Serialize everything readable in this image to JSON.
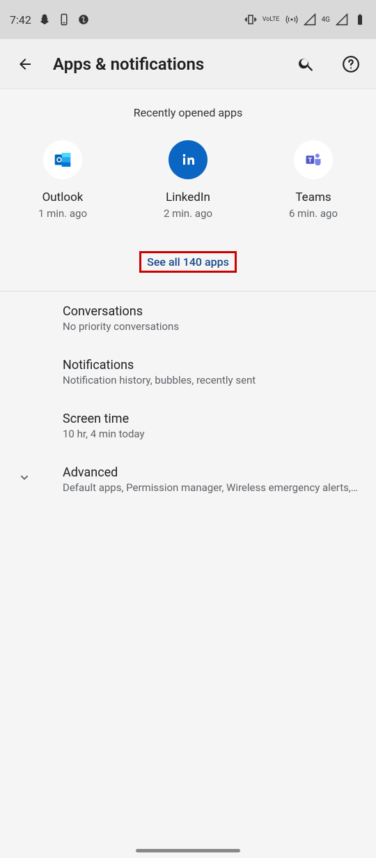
{
  "status": {
    "time": "7:42",
    "volte": "VoLTE",
    "network": "4G"
  },
  "header": {
    "title": "Apps & notifications"
  },
  "recent": {
    "title": "Recently opened apps",
    "apps": [
      {
        "name": "Outlook",
        "time": "1 min. ago"
      },
      {
        "name": "LinkedIn",
        "time": "2 min. ago"
      },
      {
        "name": "Teams",
        "time": "6 min. ago"
      }
    ],
    "see_all": "See all 140 apps"
  },
  "settings": [
    {
      "title": "Conversations",
      "sub": "No priority conversations"
    },
    {
      "title": "Notifications",
      "sub": "Notification history, bubbles, recently sent"
    },
    {
      "title": "Screen time",
      "sub": "10 hr, 4 min today"
    },
    {
      "title": "Advanced",
      "sub": "Default apps, Permission manager, Wireless emergency alerts, S.."
    }
  ]
}
